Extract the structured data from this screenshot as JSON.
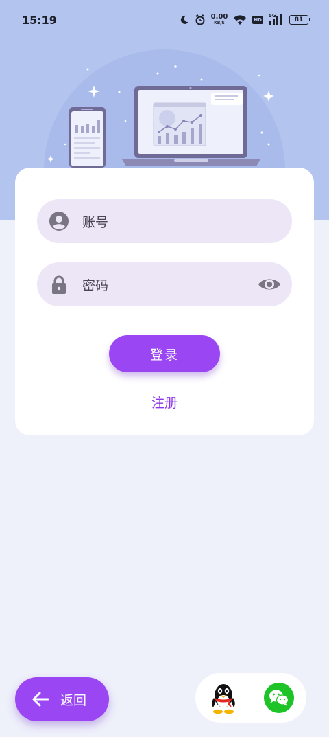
{
  "status_bar": {
    "time": "15:19",
    "net_speed_value": "0.00",
    "net_speed_unit": "KB/S",
    "hd_label": "HD",
    "network_label": "5G",
    "battery_level": "81",
    "icons": [
      "moon-icon",
      "alarm-icon",
      "wifi-icon",
      "signal-icon"
    ]
  },
  "hero": {
    "illustration": "phone-and-laptop-with-charts"
  },
  "login_form": {
    "account_placeholder": "账号",
    "password_placeholder": "密码",
    "login_label": "登录",
    "register_label": "注册"
  },
  "footer": {
    "back_label": "返回",
    "social_logins": [
      "qq",
      "wechat"
    ]
  },
  "colors": {
    "hero_bg": "#b3c4ee",
    "page_bg": "#eef0fa",
    "accent": "#9a46f3",
    "field_bg": "#ede6f7",
    "wechat_green": "#1ec328"
  }
}
